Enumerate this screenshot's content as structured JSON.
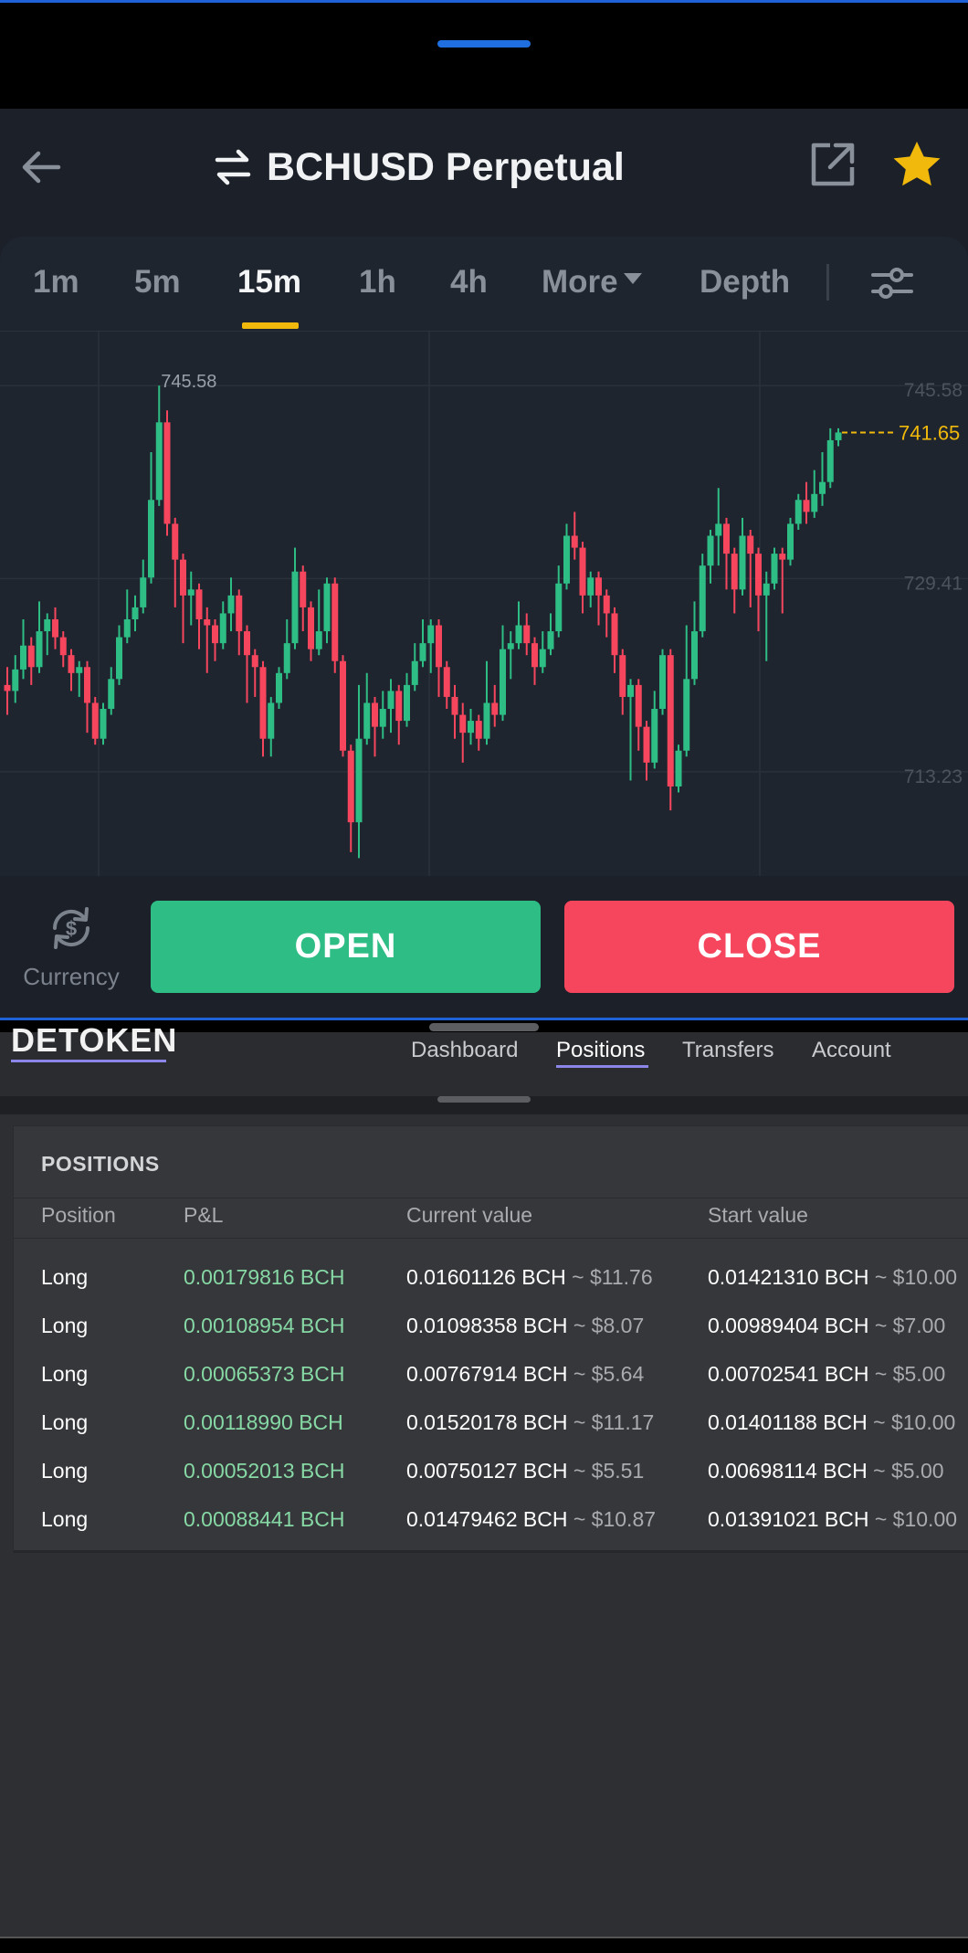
{
  "app": {
    "title": "BCHUSD Perpetual",
    "icons": [
      "back-arrow-icon",
      "swap-arrows-icon",
      "share-external-icon",
      "star-icon",
      "settings-sliders-icon",
      "currency-switch-icon"
    ]
  },
  "timeframes": {
    "items": [
      "1m",
      "5m",
      "15m",
      "1h",
      "4h",
      "More",
      "Depth"
    ],
    "active": "15m"
  },
  "chart_data": {
    "type": "candlestick",
    "title": "",
    "xlabel": "",
    "ylabel": "",
    "ylim": [
      704.5,
      750.1
    ],
    "price_ticks": [
      "745.58",
      "729.41",
      "713.23"
    ],
    "high_label": "745.58",
    "last_price": "741.65",
    "colors": {
      "up": "#2ebd85",
      "down": "#f6465d",
      "last": "#f0b90b"
    },
    "candles": [
      [
        720.5,
        720.0,
        722.0,
        718.0
      ],
      [
        720.0,
        721.8,
        723.0,
        719.0
      ],
      [
        721.8,
        723.8,
        726.0,
        721.0
      ],
      [
        723.8,
        722.0,
        724.5,
        720.5
      ],
      [
        722.0,
        725.0,
        727.5,
        721.5
      ],
      [
        725.0,
        726.0,
        726.5,
        723.0
      ],
      [
        726.0,
        724.5,
        727.0,
        723.5
      ],
      [
        724.5,
        723.0,
        725.0,
        722.0
      ],
      [
        723.0,
        721.5,
        723.5,
        720.0
      ],
      [
        721.5,
        722.0,
        722.5,
        719.5
      ],
      [
        722.0,
        719.0,
        722.5,
        716.5
      ],
      [
        719.0,
        716.0,
        719.5,
        715.5
      ],
      [
        716.0,
        718.5,
        719.0,
        715.5
      ],
      [
        718.5,
        721.0,
        722.0,
        718.0
      ],
      [
        721.0,
        724.5,
        725.5,
        720.5
      ],
      [
        724.5,
        726.0,
        728.5,
        724.0
      ],
      [
        726.0,
        727.0,
        728.0,
        725.0
      ],
      [
        727.0,
        729.5,
        731.0,
        726.5
      ],
      [
        729.5,
        736.0,
        740.0,
        729.0
      ],
      [
        736.0,
        742.5,
        745.58,
        735.5
      ],
      [
        742.5,
        734.0,
        743.5,
        733.0
      ],
      [
        734.0,
        731.0,
        734.5,
        727.0
      ],
      [
        731.0,
        728.0,
        731.5,
        724.0
      ],
      [
        728.0,
        728.5,
        730.0,
        725.5
      ],
      [
        728.5,
        726.0,
        729.0,
        723.5
      ],
      [
        726.0,
        725.5,
        727.0,
        721.5
      ],
      [
        725.5,
        724.0,
        726.0,
        722.5
      ],
      [
        724.0,
        726.5,
        727.5,
        723.5
      ],
      [
        726.5,
        728.0,
        729.5,
        725.0
      ],
      [
        728.0,
        725.0,
        728.5,
        723.0
      ],
      [
        725.0,
        723.0,
        725.5,
        719.0
      ],
      [
        723.0,
        722.0,
        723.5,
        719.5
      ],
      [
        722.0,
        716.0,
        722.5,
        714.5
      ],
      [
        716.0,
        719.0,
        719.5,
        714.5
      ],
      [
        719.0,
        721.5,
        722.0,
        718.5
      ],
      [
        721.5,
        724.0,
        726.0,
        721.0
      ],
      [
        724.0,
        730.0,
        732.0,
        723.5
      ],
      [
        730.0,
        727.0,
        730.5,
        725.0
      ],
      [
        727.0,
        723.5,
        727.5,
        722.5
      ],
      [
        723.5,
        725.0,
        728.5,
        723.0
      ],
      [
        725.0,
        729.0,
        729.5,
        724.0
      ],
      [
        729.0,
        722.5,
        729.5,
        721.5
      ],
      [
        722.5,
        715.0,
        723.0,
        714.5
      ],
      [
        715.0,
        709.0,
        715.5,
        706.5
      ],
      [
        709.0,
        716.0,
        720.5,
        706.0
      ],
      [
        716.0,
        719.0,
        721.5,
        715.5
      ],
      [
        719.0,
        717.0,
        719.5,
        714.5
      ],
      [
        717.0,
        718.5,
        720.0,
        716.0
      ],
      [
        718.5,
        720.0,
        721.0,
        716.5
      ],
      [
        720.0,
        717.5,
        720.5,
        715.5
      ],
      [
        717.5,
        720.5,
        721.5,
        717.0
      ],
      [
        720.5,
        722.5,
        724.0,
        720.0
      ],
      [
        722.5,
        724.0,
        726.0,
        722.0
      ],
      [
        724.0,
        725.5,
        726.0,
        721.5
      ],
      [
        725.5,
        722.0,
        726.0,
        719.5
      ],
      [
        722.0,
        719.5,
        722.5,
        718.5
      ],
      [
        719.5,
        718.0,
        720.5,
        716.0
      ],
      [
        718.0,
        716.5,
        719.0,
        714.0
      ],
      [
        716.5,
        717.5,
        718.5,
        715.5
      ],
      [
        717.5,
        716.0,
        718.0,
        715.0
      ],
      [
        716.0,
        719.0,
        722.5,
        715.5
      ],
      [
        719.0,
        718.0,
        720.5,
        717.0
      ],
      [
        718.0,
        723.5,
        725.5,
        717.5
      ],
      [
        723.5,
        724.0,
        725.0,
        721.0
      ],
      [
        724.0,
        725.5,
        727.5,
        723.5
      ],
      [
        725.5,
        724.0,
        726.5,
        723.0
      ],
      [
        724.0,
        722.0,
        724.5,
        720.5
      ],
      [
        722.0,
        723.5,
        725.0,
        721.5
      ],
      [
        723.5,
        725.0,
        726.5,
        723.0
      ],
      [
        725.0,
        729.0,
        730.5,
        724.5
      ],
      [
        729.0,
        733.0,
        734.0,
        728.5
      ],
      [
        733.0,
        732.0,
        735.0,
        731.0
      ],
      [
        732.0,
        728.0,
        732.5,
        726.5
      ],
      [
        728.0,
        729.5,
        730.0,
        727.0
      ],
      [
        729.5,
        728.0,
        730.0,
        725.5
      ],
      [
        728.0,
        726.5,
        728.5,
        724.5
      ],
      [
        726.5,
        723.0,
        727.0,
        721.5
      ],
      [
        723.0,
        719.5,
        723.5,
        718.0
      ],
      [
        719.5,
        720.5,
        721.0,
        712.5
      ],
      [
        720.5,
        717.0,
        721.0,
        715.0
      ],
      [
        717.0,
        714.0,
        717.5,
        712.5
      ],
      [
        714.0,
        718.5,
        720.0,
        713.5
      ],
      [
        718.5,
        723.0,
        723.5,
        718.0
      ],
      [
        723.0,
        712.0,
        723.5,
        710.0
      ],
      [
        712.0,
        715.0,
        715.5,
        711.5
      ],
      [
        715.0,
        721.0,
        725.5,
        714.5
      ],
      [
        721.0,
        725.0,
        727.5,
        720.5
      ],
      [
        725.0,
        730.5,
        731.5,
        724.5
      ],
      [
        730.5,
        733.0,
        733.5,
        729.0
      ],
      [
        733.0,
        734.0,
        737.0,
        730.5
      ],
      [
        734.0,
        731.5,
        734.5,
        728.5
      ],
      [
        731.5,
        728.5,
        732.0,
        726.5
      ],
      [
        728.5,
        733.0,
        734.5,
        728.0
      ],
      [
        733.0,
        731.5,
        733.5,
        727.0
      ],
      [
        731.5,
        728.0,
        732.0,
        725.0
      ],
      [
        728.0,
        729.0,
        730.0,
        722.5
      ],
      [
        729.0,
        731.5,
        732.0,
        728.5
      ],
      [
        731.5,
        731.0,
        732.0,
        726.5
      ],
      [
        731.0,
        734.0,
        734.5,
        730.5
      ],
      [
        734.0,
        736.0,
        736.5,
        733.5
      ],
      [
        736.0,
        735.0,
        737.5,
        734.0
      ],
      [
        735.0,
        736.5,
        738.5,
        734.5
      ],
      [
        736.5,
        737.5,
        740.0,
        735.5
      ],
      [
        737.5,
        741.0,
        742.0,
        737.0
      ],
      [
        741.0,
        741.65,
        742.0,
        740.5
      ]
    ]
  },
  "actions": {
    "currency_label": "Currency",
    "open_label": "OPEN",
    "close_label": "CLOSE"
  },
  "web": {
    "logo_text": "DETOKEN",
    "nav": [
      "Dashboard",
      "Positions",
      "Transfers",
      "Account"
    ],
    "nav_active": "Positions"
  },
  "positions": {
    "title": "POSITIONS",
    "columns": [
      "Position",
      "P&L",
      "Current value",
      "Start value"
    ],
    "rows": [
      {
        "position": "Long",
        "pnl": "0.00179816 BCH",
        "current": "0.01601126 BCH",
        "current_usd": "~ $11.76",
        "start": "0.01421310 BCH",
        "start_usd": "~ $10.00"
      },
      {
        "position": "Long",
        "pnl": "0.00108954 BCH",
        "current": "0.01098358 BCH",
        "current_usd": "~ $8.07",
        "start": "0.00989404 BCH",
        "start_usd": "~ $7.00"
      },
      {
        "position": "Long",
        "pnl": "0.00065373 BCH",
        "current": "0.00767914 BCH",
        "current_usd": "~ $5.64",
        "start": "0.00702541 BCH",
        "start_usd": "~ $5.00"
      },
      {
        "position": "Long",
        "pnl": "0.00118990 BCH",
        "current": "0.01520178 BCH",
        "current_usd": "~ $11.17",
        "start": "0.01401188 BCH",
        "start_usd": "~ $10.00"
      },
      {
        "position": "Long",
        "pnl": "0.00052013 BCH",
        "current": "0.00750127 BCH",
        "current_usd": "~ $5.51",
        "start": "0.00698114 BCH",
        "start_usd": "~ $5.00"
      },
      {
        "position": "Long",
        "pnl": "0.00088441 BCH",
        "current": "0.01479462 BCH",
        "current_usd": "~ $10.87",
        "start": "0.01391021 BCH",
        "start_usd": "~ $10.00"
      }
    ]
  }
}
